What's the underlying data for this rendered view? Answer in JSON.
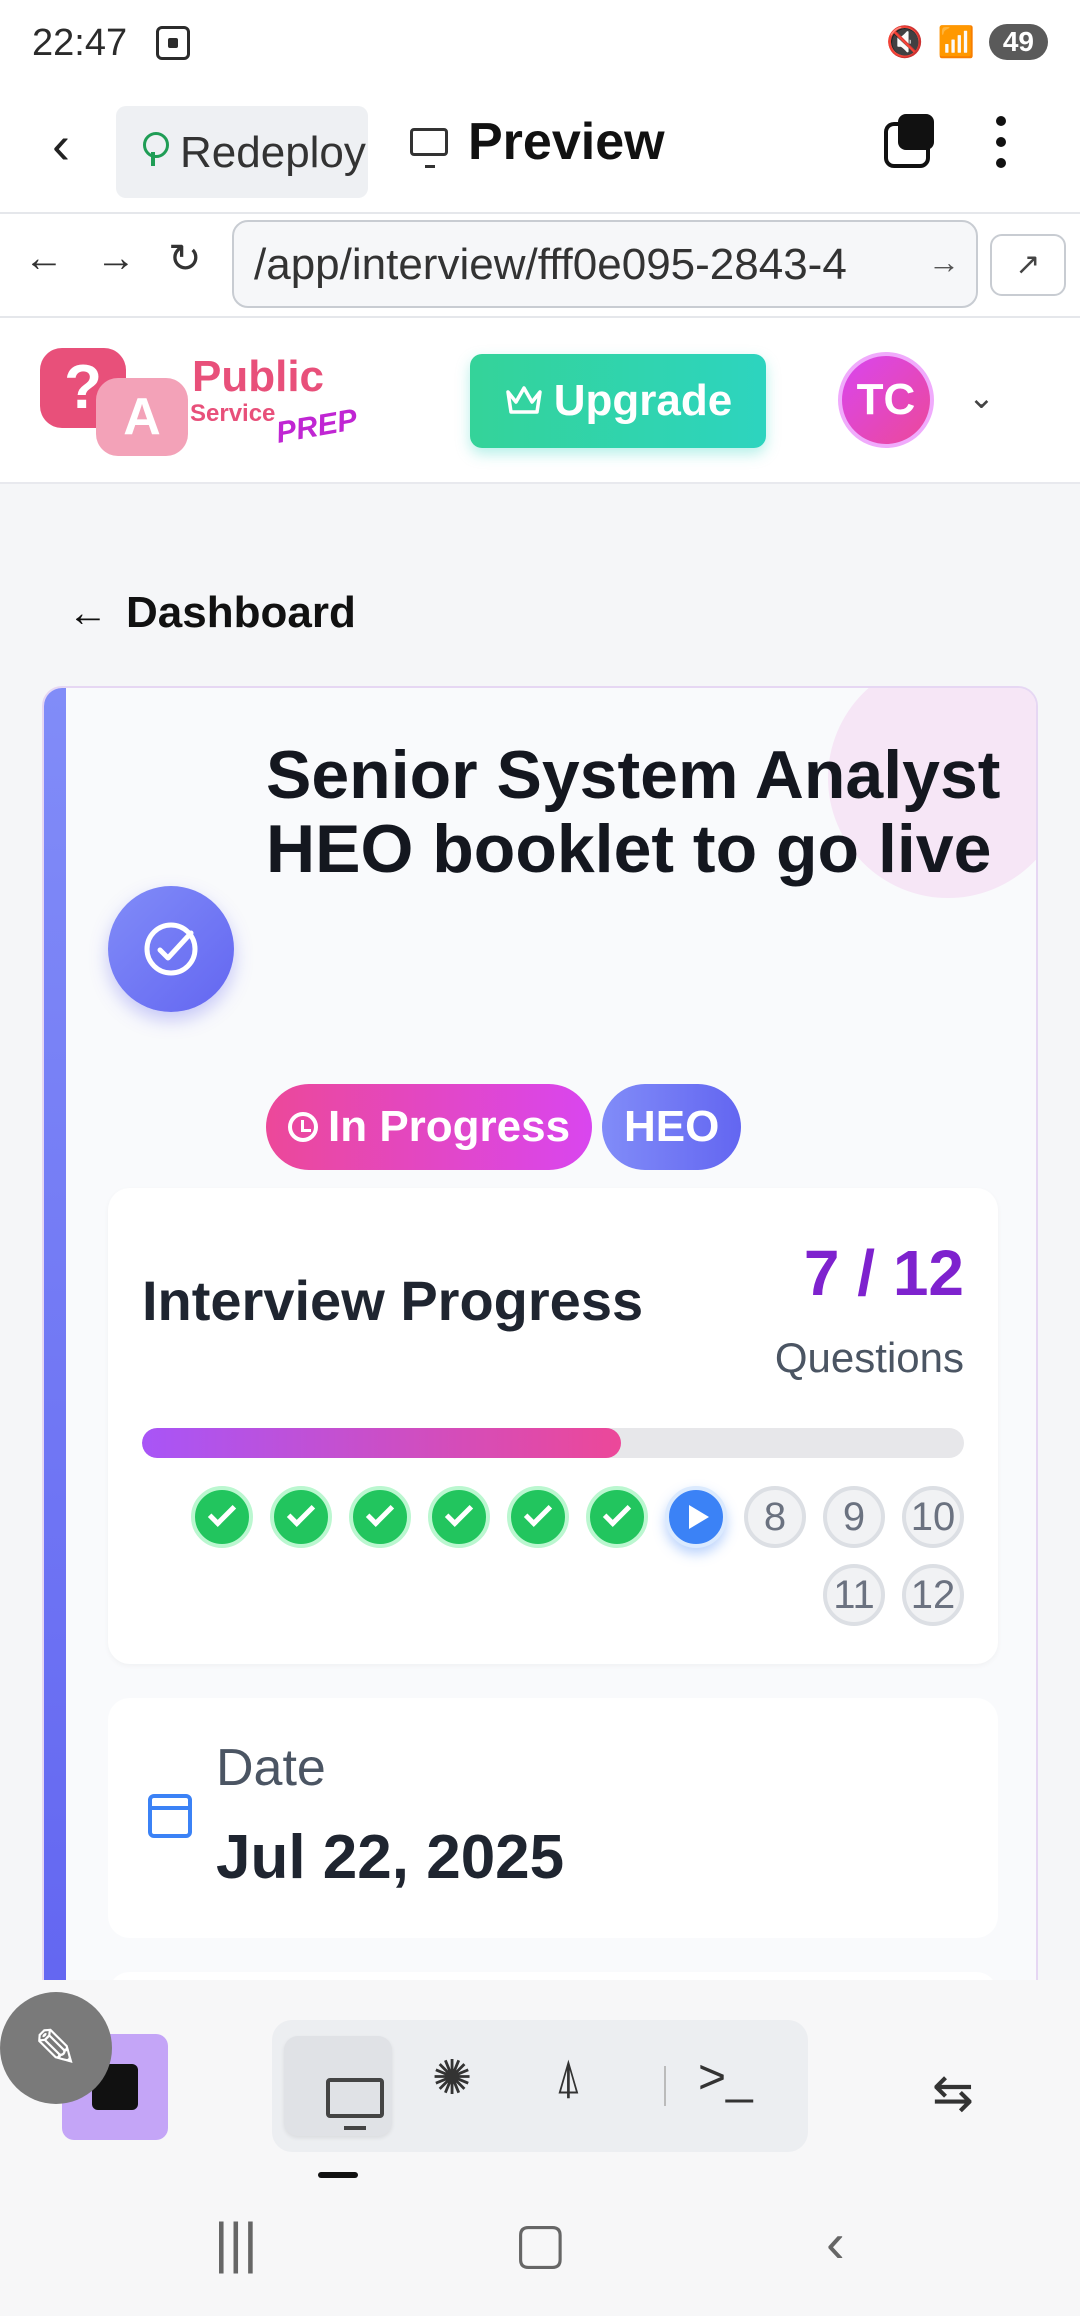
{
  "status_bar": {
    "time": "22:47",
    "battery": "49"
  },
  "browser": {
    "project_label": "Redeploy",
    "preview_title": "Preview",
    "url": "/app/interview/fff0e095-2843-4",
    "back_glyph": "‹",
    "nav_back": "←",
    "nav_forward": "→",
    "reload": "↻",
    "go_glyph": "→",
    "external_glyph": "↗"
  },
  "app_header": {
    "logo_text_public": "Public",
    "logo_text_service": "Service",
    "logo_text_prep": "PREP",
    "logo_q": "?",
    "logo_a": "A",
    "upgrade_label": "Upgrade",
    "avatar_initials": "TC",
    "avatar_chevron": "⌄"
  },
  "breadcrumb": {
    "label": "Dashboard",
    "arrow": "←"
  },
  "interview": {
    "title": "Senior System Analyst HEO booklet to go live",
    "status": "In Progress",
    "grade": "HEO",
    "progress": {
      "title": "Interview Progress",
      "count": "7 / 12",
      "subtitle": "Questions",
      "fraction": 0.583,
      "steps": [
        {
          "n": "1",
          "state": "done"
        },
        {
          "n": "2",
          "state": "done"
        },
        {
          "n": "3",
          "state": "done"
        },
        {
          "n": "4",
          "state": "done"
        },
        {
          "n": "5",
          "state": "done"
        },
        {
          "n": "6",
          "state": "done"
        },
        {
          "n": "7",
          "state": "current"
        },
        {
          "n": "8",
          "state": "todo"
        },
        {
          "n": "9",
          "state": "todo"
        },
        {
          "n": "10",
          "state": "todo"
        },
        {
          "n": "11",
          "state": "todo"
        },
        {
          "n": "12",
          "state": "todo"
        }
      ]
    },
    "date_label": "Date",
    "date_value": "Jul 22, 2025"
  },
  "toolbar": {
    "edit_glyph": "✎",
    "terminal_glyph": ">_",
    "grid_glyph": "✺",
    "tree_glyph": "⍋",
    "rotate_glyph": "⇆"
  },
  "navbar": {
    "recents": "|||",
    "home": "▢",
    "back": "‹"
  },
  "colors": {
    "accent_purple": "#7e22ce",
    "upgrade_green": "#34d399",
    "status_pink": "#ec4899",
    "done_green": "#22c55e",
    "current_blue": "#3b82f6"
  }
}
